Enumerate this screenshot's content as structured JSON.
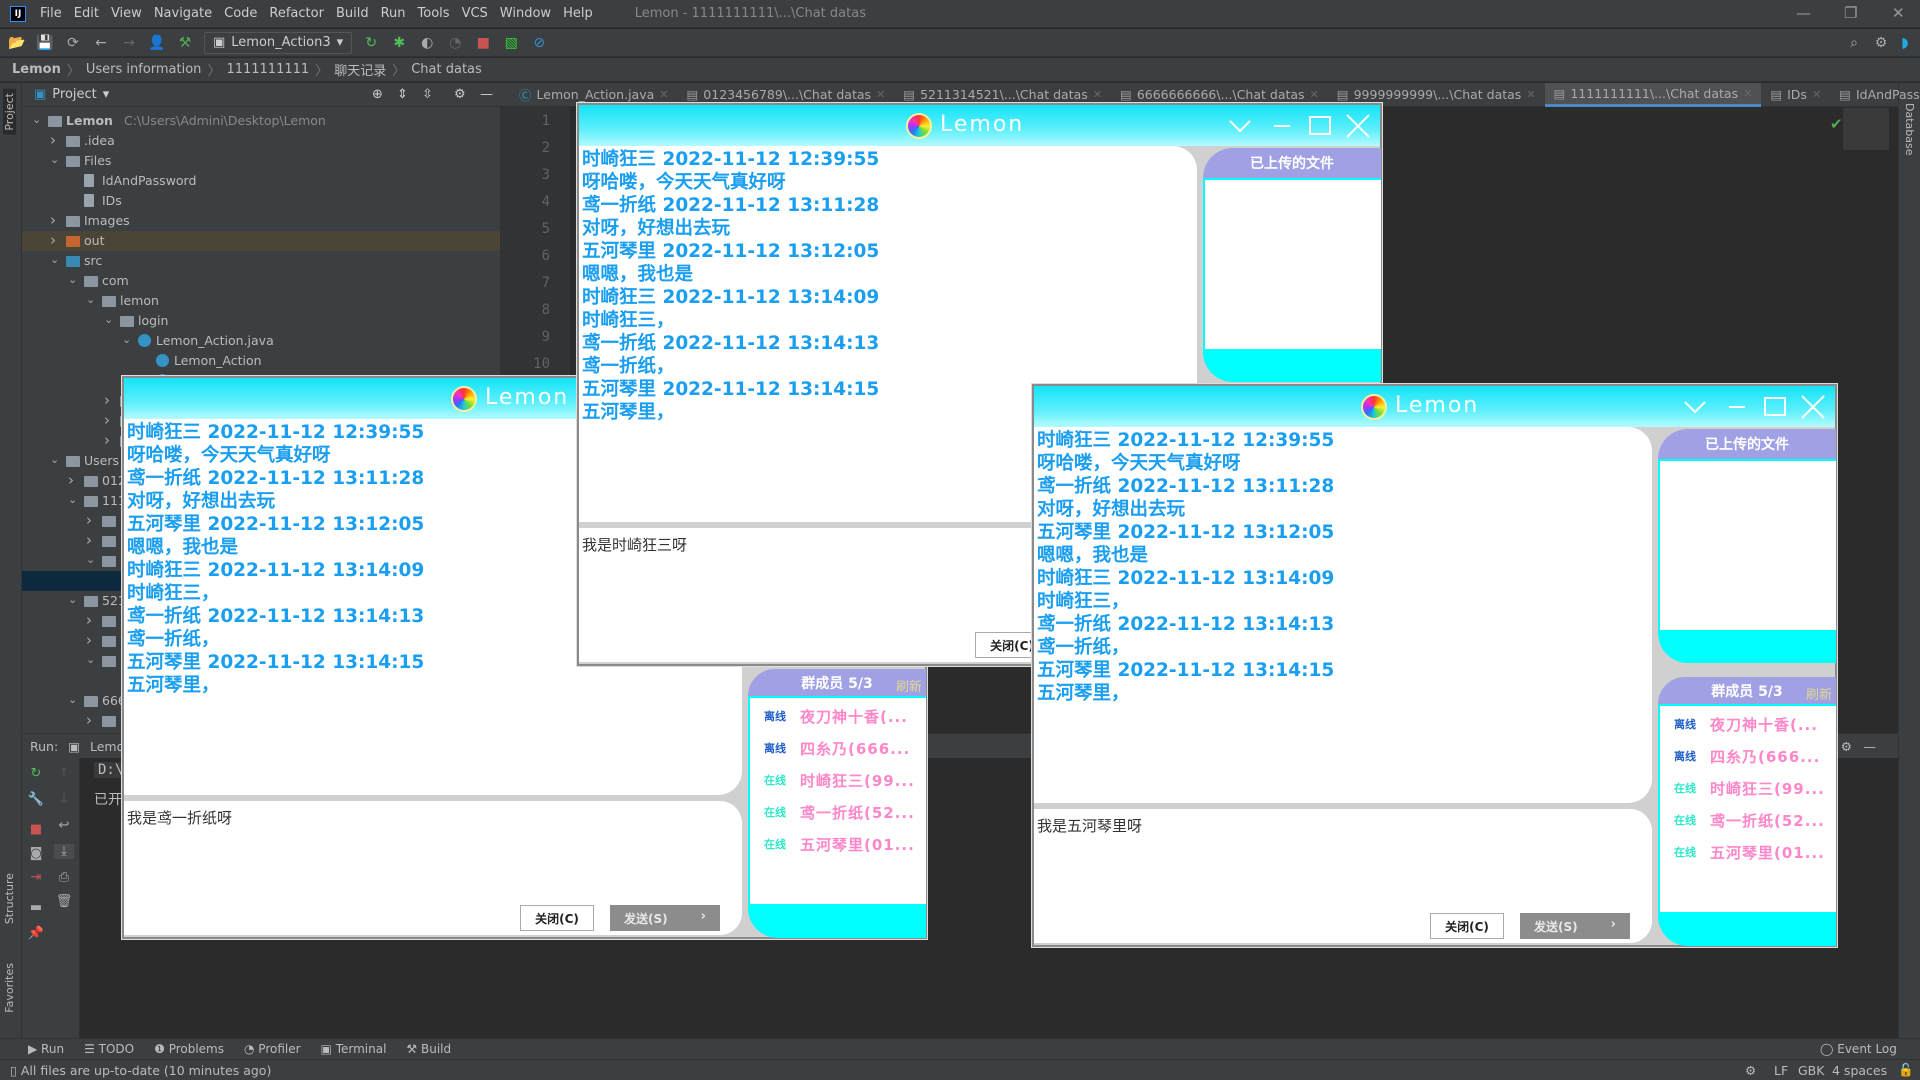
{
  "ide": {
    "title": "Lemon - 1111111111\\...\\Chat datas",
    "menu": [
      "File",
      "Edit",
      "View",
      "Navigate",
      "Code",
      "Refactor",
      "Build",
      "Run",
      "Tools",
      "VCS",
      "Window",
      "Help"
    ],
    "run_config": "Lemon_Action3",
    "breadcrumb": [
      "Lemon",
      "Users information",
      "1111111111",
      "聊天记录",
      "Chat datas"
    ],
    "project_label": "Project",
    "left_strip": [
      "Project",
      "Structure",
      "Favorites"
    ],
    "right_strip": [
      "Database"
    ],
    "tabs": [
      {
        "label": "Lemon_Action.java",
        "icon": "java-class-icon"
      },
      {
        "label": "0123456789\\...\\Chat datas",
        "icon": "text-file-icon"
      },
      {
        "label": "5211314521\\...\\Chat datas",
        "icon": "text-file-icon"
      },
      {
        "label": "6666666666\\...\\Chat datas",
        "icon": "text-file-icon"
      },
      {
        "label": "9999999999\\...\\Chat datas",
        "icon": "text-file-icon"
      },
      {
        "label": "1111111111\\...\\Chat datas",
        "icon": "text-file-icon",
        "active": true
      },
      {
        "label": "IDs",
        "icon": "text-file-icon"
      },
      {
        "label": "IdAndPassword",
        "icon": "text-file-icon"
      }
    ],
    "line_numbers": [
      "1",
      "2",
      "3",
      "4",
      "5",
      "6",
      "7",
      "8",
      "9",
      "10"
    ],
    "tree": [
      {
        "level": 0,
        "arrow": "down",
        "icon": "module",
        "label": "Lemon",
        "path": "C:\\Users\\Admini\\Desktop\\Lemon"
      },
      {
        "level": 1,
        "arrow": "right",
        "icon": "folder",
        "label": ".idea"
      },
      {
        "level": 1,
        "arrow": "down",
        "icon": "folder",
        "label": "Files"
      },
      {
        "level": 2,
        "arrow": "none",
        "icon": "file",
        "label": "IdAndPassword"
      },
      {
        "level": 2,
        "arrow": "none",
        "icon": "file",
        "label": "IDs"
      },
      {
        "level": 1,
        "arrow": "right",
        "icon": "folder",
        "label": "Images"
      },
      {
        "level": 1,
        "arrow": "right",
        "icon": "folder-excluded",
        "label": "out",
        "state": "highlighted"
      },
      {
        "level": 1,
        "arrow": "down",
        "icon": "folder-source",
        "label": "src"
      },
      {
        "level": 2,
        "arrow": "down",
        "icon": "package",
        "label": "com"
      },
      {
        "level": 3,
        "arrow": "down",
        "icon": "package",
        "label": "lemon"
      },
      {
        "level": 4,
        "arrow": "down",
        "icon": "package",
        "label": "login"
      },
      {
        "level": 5,
        "arrow": "down",
        "icon": "class",
        "label": "Lemon_Action.java"
      },
      {
        "level": 6,
        "arrow": "none",
        "icon": "class",
        "label": "Lemon_Action"
      },
      {
        "level": 6,
        "arrow": "none",
        "icon": "class",
        "label": ""
      },
      {
        "level": 4,
        "arrow": "right",
        "icon": "folder",
        "label": ""
      },
      {
        "level": 4,
        "arrow": "right",
        "icon": "folder",
        "label": ""
      },
      {
        "level": 4,
        "arrow": "right",
        "icon": "folder",
        "label": ""
      },
      {
        "level": 1,
        "arrow": "down",
        "icon": "folder",
        "label": "Users information"
      },
      {
        "level": 2,
        "arrow": "right",
        "icon": "folder",
        "label": "0123456789"
      },
      {
        "level": 2,
        "arrow": "down",
        "icon": "folder",
        "label": "1111111111"
      },
      {
        "level": 3,
        "arrow": "right",
        "icon": "folder",
        "label": ""
      },
      {
        "level": 3,
        "arrow": "right",
        "icon": "folder",
        "label": ""
      },
      {
        "level": 3,
        "arrow": "down",
        "icon": "folder",
        "label": ""
      },
      {
        "level": 4,
        "arrow": "none",
        "icon": "none",
        "label": "",
        "state": "selected"
      },
      {
        "level": 2,
        "arrow": "down",
        "icon": "folder",
        "label": "5211314521"
      },
      {
        "level": 3,
        "arrow": "right",
        "icon": "folder",
        "label": ""
      },
      {
        "level": 3,
        "arrow": "right",
        "icon": "folder",
        "label": ""
      },
      {
        "level": 3,
        "arrow": "down",
        "icon": "folder",
        "label": ""
      },
      {
        "level": 4,
        "arrow": "none",
        "icon": "none",
        "label": ""
      },
      {
        "level": 2,
        "arrow": "down",
        "icon": "folder",
        "label": "6666666666"
      },
      {
        "level": 3,
        "arrow": "right",
        "icon": "folder",
        "label": ""
      }
    ],
    "run": {
      "label": "Run:",
      "tab": "Lemon_Action3",
      "console": [
        "D:\\",
        "已开"
      ]
    },
    "bottom_tools": [
      "Run",
      "TODO",
      "Problems",
      "Profiler",
      "Terminal",
      "Build"
    ],
    "event_log": "Event Log",
    "status": "All files are up-to-date (10 minutes ago)",
    "status_right": [
      "LF",
      "GBK",
      "4 spaces"
    ]
  },
  "chat": {
    "app_name": "Lemon",
    "files_header": "已上传的文件",
    "members_header": "群成员 5/3",
    "refresh": "刷新",
    "close_button": "关闭(C)",
    "send_button": "发送(S)",
    "colors": {
      "text": "#1a9ef0",
      "offline": "#2060c8",
      "online": "#2ee6c8",
      "member_name": "#ff86c8",
      "header": "#a0a0e4",
      "accent": "#00ffff"
    },
    "messages": [
      "时崎狂三 2022-11-12 12:39:55",
      "呀哈喽，今天天气真好呀",
      "鸢一折纸 2022-11-12 13:11:28",
      "对呀，好想出去玩",
      "五河琴里 2022-11-12 13:12:05",
      "嗯嗯，我也是",
      "时崎狂三 2022-11-12 13:14:09",
      "时崎狂三，",
      "鸢一折纸 2022-11-12 13:14:13",
      "鸢一折纸，",
      "五河琴里 2022-11-12 13:14:15",
      "五河琴里，"
    ],
    "members": [
      {
        "status": "离线",
        "online": false,
        "name": "夜刀神十香(..."
      },
      {
        "status": "离线",
        "online": false,
        "name": "四糸乃(666..."
      },
      {
        "status": "在线",
        "online": true,
        "name": "时崎狂三(99..."
      },
      {
        "status": "在线",
        "online": true,
        "name": "鸢一折纸(52..."
      },
      {
        "status": "在线",
        "online": true,
        "name": "五河琴里(01..."
      }
    ],
    "windows": [
      {
        "input": "我是鸢一折纸呀"
      },
      {
        "input": "我是时崎狂三呀"
      },
      {
        "input": "我是五河琴里呀"
      }
    ]
  }
}
